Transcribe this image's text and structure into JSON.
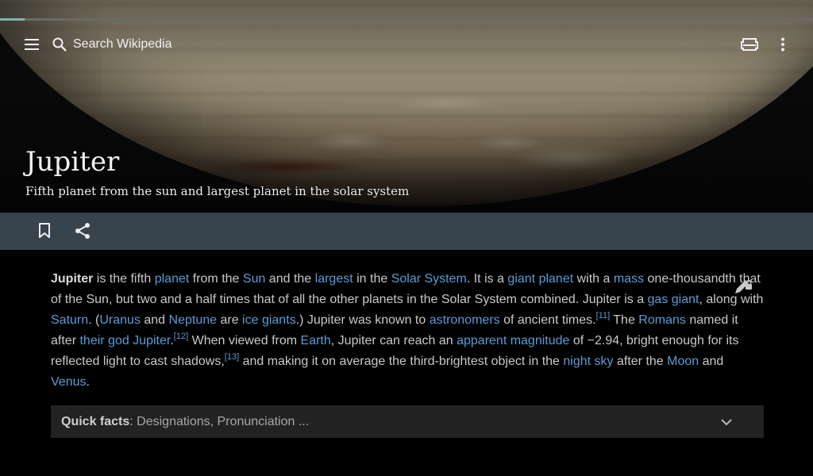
{
  "load_progress": 0.03,
  "colors": {
    "link": "#5b9bd5",
    "action_bar": "#37434d",
    "page_background": "#000000",
    "quickfacts_background": "#222222",
    "progress": "#7fb5b0"
  },
  "toolbar": {
    "menu_icon": "menu-icon",
    "search_icon": "search-icon",
    "search_placeholder": "Search Wikipedia",
    "reading_icon": "reading-list-icon",
    "overflow_icon": "more-vertical-icon"
  },
  "hero": {
    "title": "Jupiter",
    "subtitle": "Fifth planet from the sun and largest planet in the solar system"
  },
  "actions": {
    "bookmark_icon": "bookmark-icon",
    "share_icon": "share-icon",
    "edit_icon": "edit-lock-icon"
  },
  "article": {
    "s1": "Jupiter",
    "s2": " is the fifth ",
    "l_planet": "planet",
    "s3": " from the ",
    "l_sun": "Sun",
    "s4": " and the ",
    "l_largest": "largest",
    "s5": " in the ",
    "l_solar_system": "Solar System",
    "s6": ". It is a ",
    "l_giant_planet": "giant planet",
    "s7": " with a ",
    "l_mass": "mass",
    "s8": " one-thousandth that of the Sun, but two and a half times that of all the other planets in the Solar System combined. Jupiter is a ",
    "l_gas_giant": "gas giant",
    "s9": ", along with ",
    "l_saturn": "Saturn",
    "s10": ". (",
    "l_uranus": "Uranus",
    "s11": " and ",
    "l_neptune": "Neptune",
    "s12": " are ",
    "l_ice_giants": "ice giants",
    "s13": ".) Jupiter was known to ",
    "l_astronomers": "astronomers",
    "s14": " of ancient times.",
    "ref11": "[11]",
    "s15": " The ",
    "l_romans": "Romans",
    "s16": " named it after ",
    "l_their_god": "their god Jupiter",
    "s17": ".",
    "ref12": "[12]",
    "s18": " When viewed from ",
    "l_earth": "Earth",
    "s19": ", Jupiter can reach an ",
    "l_apparent_magnitude": "apparent magnitude",
    "s20": " of −2.94, bright enough for its reflected light to cast shadows,",
    "ref13": "[13]",
    "s21": " and making it on average the third-brightest object in the ",
    "l_night_sky": "night sky",
    "s22": " after the ",
    "l_moon": "Moon",
    "s23": " and ",
    "l_venus": "Venus",
    "s24": "."
  },
  "quickfacts": {
    "title": "Quick facts",
    "summary": ": Designations, Pronunciation ...",
    "chevron_icon": "chevron-down-icon"
  }
}
